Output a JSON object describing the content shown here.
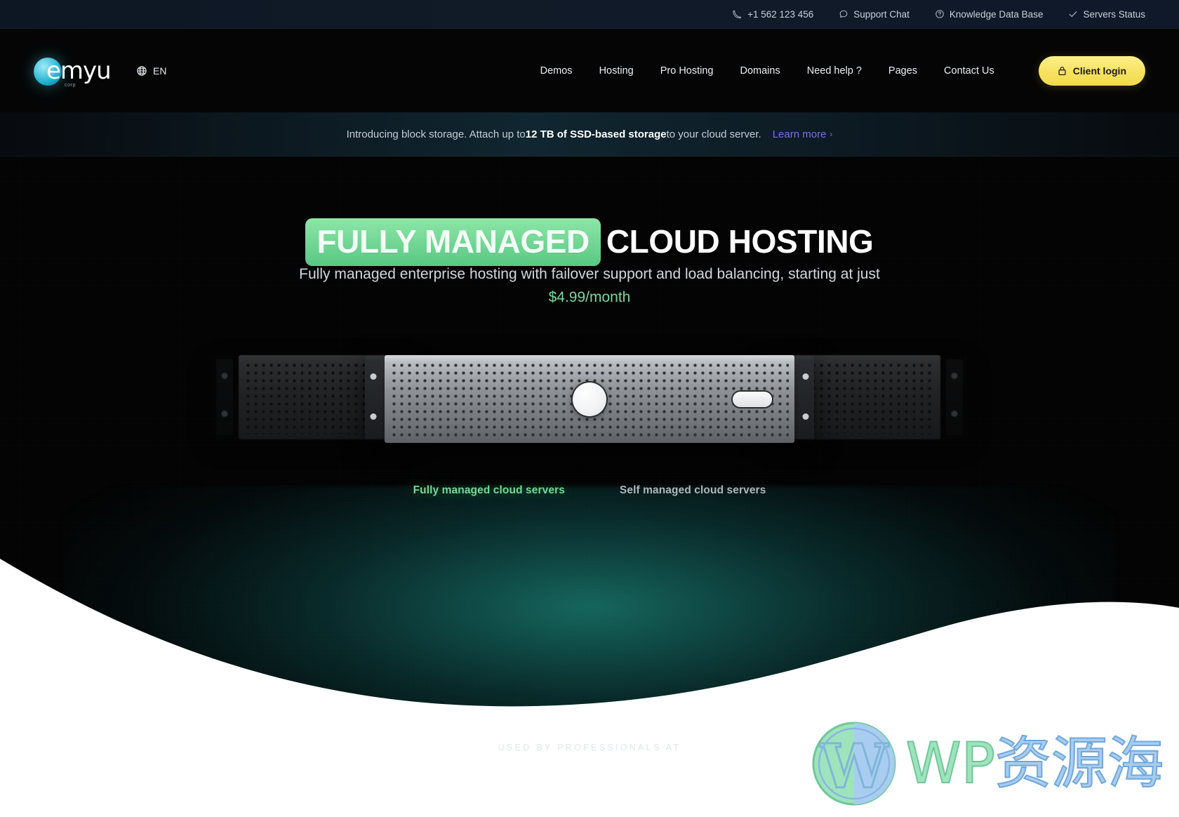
{
  "topbar": {
    "items": [
      {
        "label": "+1 562 123 456",
        "icon": "phone-icon"
      },
      {
        "label": "Support Chat",
        "icon": "chat-icon"
      },
      {
        "label": "Knowledge Data Base",
        "icon": "question-circle-icon"
      },
      {
        "label": "Servers Status",
        "icon": "check-icon"
      }
    ]
  },
  "header": {
    "logo": {
      "wordmark": "emyu",
      "subtext": "corp"
    },
    "language": {
      "label": "EN",
      "icon": "globe-icon"
    },
    "nav": [
      {
        "label": "Demos"
      },
      {
        "label": "Hosting"
      },
      {
        "label": "Pro Hosting"
      },
      {
        "label": "Domains"
      },
      {
        "label": "Need help ?"
      },
      {
        "label": "Pages"
      },
      {
        "label": "Contact Us"
      }
    ],
    "login": {
      "label": "Client login",
      "icon": "lock-icon"
    }
  },
  "announcement": {
    "prefix": "Introducing block storage. Attach up to ",
    "bold": "12 TB of SSD-based storage",
    "suffix": " to your cloud server.",
    "link": "Learn more",
    "chevron": "›"
  },
  "hero": {
    "title_highlight": "FULLY MANAGED",
    "title_rest": "CLOUD HOSTING",
    "subtitle_line1": "Fully managed enterprise hosting with failover support and load balancing, starting at",
    "subtitle_line2_prefix": "just ",
    "price": "$4.99/month",
    "tabs": [
      {
        "label": "Fully managed cloud servers",
        "active": true
      },
      {
        "label": "Self managed cloud servers",
        "active": false
      }
    ]
  },
  "footer": {
    "used_by": "USED BY PROFESSIONALS AT"
  },
  "watermark": {
    "wp": "WP",
    "cn": "资源海"
  },
  "colors": {
    "accent_green": "#6ed492",
    "accent_yellow": "#f7e261",
    "link_purple": "#7b6cf0",
    "logo_cyan": "#4fc8e0"
  }
}
